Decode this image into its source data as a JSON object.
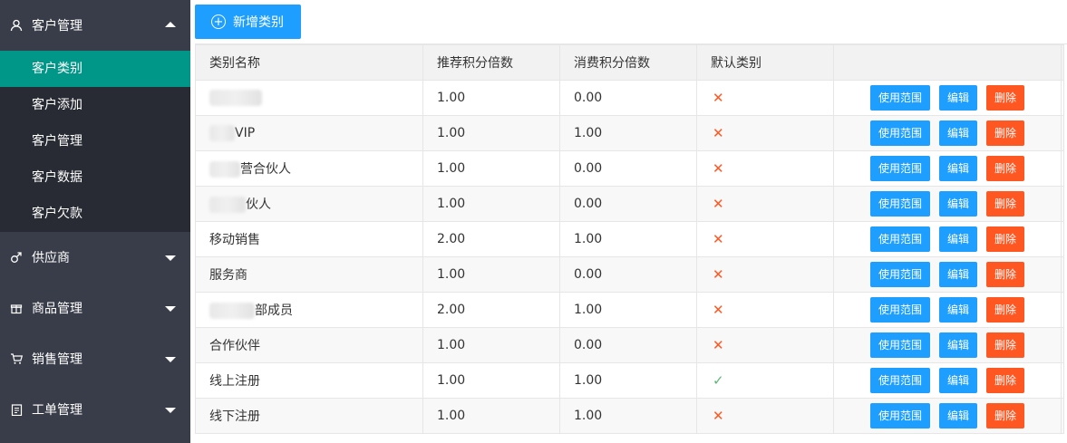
{
  "sidebar": {
    "groups": [
      {
        "label": "客户管理",
        "icon": "user-icon",
        "expanded": true,
        "items": [
          "客户类别",
          "客户添加",
          "客户管理",
          "客户数据",
          "客户欠款"
        ]
      },
      {
        "label": "供应商",
        "icon": "male-icon",
        "expanded": false
      },
      {
        "label": "商品管理",
        "icon": "gift-icon",
        "expanded": false
      },
      {
        "label": "销售管理",
        "icon": "cart-icon",
        "expanded": false
      },
      {
        "label": "工单管理",
        "icon": "clipboard-icon",
        "expanded": false
      }
    ]
  },
  "toolbar": {
    "add_label": "新增类别"
  },
  "table": {
    "headers": [
      "类别名称",
      "推荐积分倍数",
      "消费积分倍数",
      "默认类别"
    ],
    "rows": [
      {
        "name": "",
        "rec": "1.00",
        "use": "0.00",
        "default": false
      },
      {
        "name": "VIP",
        "rec": "1.00",
        "use": "1.00",
        "default": false
      },
      {
        "name": "营合伙人",
        "rec": "1.00",
        "use": "0.00",
        "default": false
      },
      {
        "name": "伙人",
        "rec": "1.00",
        "use": "0.00",
        "default": false
      },
      {
        "name": "移动销售",
        "rec": "2.00",
        "use": "1.00",
        "default": false
      },
      {
        "name": "服务商",
        "rec": "1.00",
        "use": "0.00",
        "default": false
      },
      {
        "name": "部成员",
        "rec": "2.00",
        "use": "1.00",
        "default": false
      },
      {
        "name": "合作伙伴",
        "rec": "1.00",
        "use": "0.00",
        "default": false
      },
      {
        "name": "线上注册",
        "rec": "1.00",
        "use": "1.00",
        "default": true
      },
      {
        "name": "线下注册",
        "rec": "1.00",
        "use": "1.00",
        "default": false
      }
    ],
    "actions": {
      "scope": "使用范围",
      "edit": "编辑",
      "delete": "删除"
    },
    "marks": {
      "yes": "✓",
      "no": "✕"
    }
  },
  "colors": {
    "sidebar_bg": "#393d49",
    "submenu_bg": "#282b33",
    "active": "#009688",
    "primary": "#1e9fff",
    "danger": "#ff5722",
    "ok": "#5fb878"
  }
}
